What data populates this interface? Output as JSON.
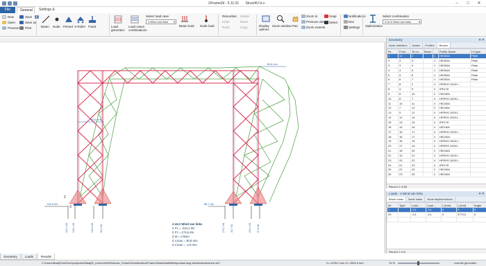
{
  "window": {
    "title": "XFrame2d - 5.11.01",
    "company": "Struct4U b.v."
  },
  "menu": {
    "file": "File",
    "general": "General",
    "settings": "Settings & Manual"
  },
  "ribbon": {
    "new": "New",
    "save": "Save",
    "open": "Open",
    "save_as": "Save as",
    "preview": "Preview",
    "print": "Print",
    "rtf_output": "RTF output",
    "pdf_output": "PDF output",
    "beam": "Beam",
    "node": "Node",
    "pinned": "Pinned",
    "x_roller": "X-Roller",
    "fixed": "Fixed",
    "load_generator": "Load generator",
    "load_cases_combinations": "Load cases combinations",
    "select_load_case_label": "Select load case",
    "select_load_case_value": "4 Wind van links",
    "beam_load": "Beam load",
    "node_load": "Node load",
    "renumber": "Renumber",
    "undo": "Undo",
    "redo": "Redo",
    "delete": "Delete",
    "move": "Move",
    "copy": "Copy",
    "display_options": "Display options",
    "zoom_window": "Zoom window",
    "pan": "Pan",
    "zoom_in": "Zoom in",
    "previous_view": "Previous view",
    "zoom_extents": "Zoom extents",
    "snap": "Snap",
    "select": "Select",
    "notifications": "Notifications",
    "dev": "Dev",
    "settings": "Settings",
    "optimization": "Optimization",
    "select_combination_label": "Select combination",
    "select_combination_value": "4 ULS Wind van links"
  },
  "drawing": {
    "dim_top": "36,8 mm",
    "dim_left": "55,6 mm",
    "dim_bl": "139,6 kN",
    "dim_br": "88,7 kN",
    "label_z": "Z",
    "label_x": "X",
    "reactions": [
      "121,4 kN",
      "145,4 kN",
      "140,9 kN",
      "35,2 kN",
      "270,7 kN",
      "40,7 kN",
      "210,4 kN",
      "37,6 kN"
    ],
    "summary_title": "4 ULS Wind van links",
    "summary_lines": [
      "Σ Fx = -224,1 kN",
      "Σ Fz = 174,6 kN",
      "Σ M = 0 kNm",
      "d x;max = 36,8 mm",
      "d z;max = -4,8 mm"
    ]
  },
  "viewport_tabs": [
    "Geometry",
    "Loads",
    "Results"
  ],
  "geometry_panel": {
    "title": "Geometry",
    "subtabs": [
      "Node definition",
      "Nodes",
      "Profiles",
      "Beams"
    ],
    "columns": [
      "Nr.",
      "From ...",
      "To no...",
      "Beam ...",
      "",
      "Profile Name",
      "LY-type"
    ],
    "rows": [
      [
        "1",
        "12",
        "2",
        "",
        "1",
        "HE300A",
        "Plate"
      ],
      [
        "2",
        "3",
        "3",
        "",
        "1",
        "HE300A",
        "Plate"
      ],
      [
        "3",
        "3",
        "4",
        "",
        "1",
        "HE300A",
        "Plate"
      ],
      [
        "4",
        "4",
        "5",
        "",
        "1",
        "HE300A",
        "Plate"
      ],
      [
        "5",
        "5",
        "6",
        "",
        "1",
        "HE300A",
        "Plate"
      ],
      [
        "6",
        "6",
        "7",
        "",
        "1",
        "HE300A",
        "Plate"
      ],
      [
        "7",
        "8",
        "2",
        "",
        "4",
        "HFRHS 100X1...",
        ""
      ],
      [
        "8",
        "3",
        "9",
        "",
        "4",
        "IPE178",
        ""
      ],
      [
        "9",
        "8",
        "10",
        "",
        "2",
        "HE240A",
        ""
      ],
      [
        "10",
        "8",
        "7",
        "",
        "4",
        "HFRHS 100X1...",
        ""
      ],
      [
        "11",
        "10",
        "11",
        "",
        "2",
        "HE240A",
        ""
      ],
      [
        "12",
        "7",
        "12",
        "",
        "2",
        "HE240A",
        ""
      ],
      [
        "13",
        "9",
        "11",
        "",
        "4",
        "HFRHS 100X1...",
        ""
      ],
      [
        "14",
        "12",
        "14",
        "",
        "4",
        "HFRHS 100X1...",
        ""
      ],
      [
        "15",
        "13",
        "15",
        "",
        "4",
        "IPE178",
        ""
      ],
      [
        "16",
        "14",
        "16",
        "",
        "2",
        "HE240A",
        ""
      ],
      [
        "17",
        "15",
        "17",
        "",
        "4",
        "HFRHS 100X1...",
        ""
      ],
      [
        "18",
        "16",
        "17",
        "",
        "2",
        "HE240A",
        ""
      ],
      [
        "19",
        "16",
        "18",
        "",
        "4",
        "HFRHS 100X1...",
        ""
      ],
      [
        "20",
        "17",
        "19",
        "",
        "4",
        "HFRHS 100X1...",
        ""
      ],
      [
        "21",
        "18",
        "20",
        "",
        "2",
        "HE240A",
        ""
      ],
      [
        "22",
        "19",
        "21",
        "",
        "4",
        "HFRHS 100X1...",
        ""
      ],
      [
        "23",
        "20",
        "22",
        "",
        "4",
        "HFRHS 100X1...",
        ""
      ],
      [
        "24",
        "21",
        "23",
        "",
        "4",
        "IPE178",
        ""
      ],
      [
        "25",
        "22",
        "24",
        "",
        "2",
        "HE240A",
        ""
      ],
      [
        "26",
        "23",
        "25",
        "",
        "2",
        "HE240A",
        ""
      ]
    ],
    "nav": "Record 1 of 63"
  },
  "loads_panel": {
    "title": "Loads - 4 Wind van links",
    "subtabs": [
      "Beam loads",
      "Node loads",
      "Node displacements"
    ],
    "columns": [
      "Nr.",
      "Type",
      "Load ...",
      "Load ...",
      "L [mm]",
      "L [mm]",
      "Angle"
    ],
    "rows": [
      [
        "1",
        "",
        "-3,1",
        "-3,1",
        "0",
        "0",
        "0"
      ],
      [
        "29",
        "",
        "-3,1",
        "-3,1",
        "0",
        "3770,0",
        "0"
      ],
      [
        "",
        "",
        "",
        "",
        "",
        "",
        ""
      ]
    ],
    "nav": "Record 1 of 3"
  },
  "statusbar": {
    "path": "C:\\Users\\Baaij\\OneDrive\\projecten\\Baaij\\D_intern\\civil\\Windows_Frame2d\\verification\\Frame2d\\stal\\stabiliteitsportaal laag middenstramienen.xfr2",
    "coords": "X=-2135,0 mm  Z=-2094,5 mm",
    "zoom": "76 %",
    "license": "Licentie gevonden"
  },
  "colors": {
    "accent": "#2c65a5",
    "structure": "#d9304f",
    "deformed": "#4a9a3e",
    "reaction_fill": "#e88080"
  }
}
